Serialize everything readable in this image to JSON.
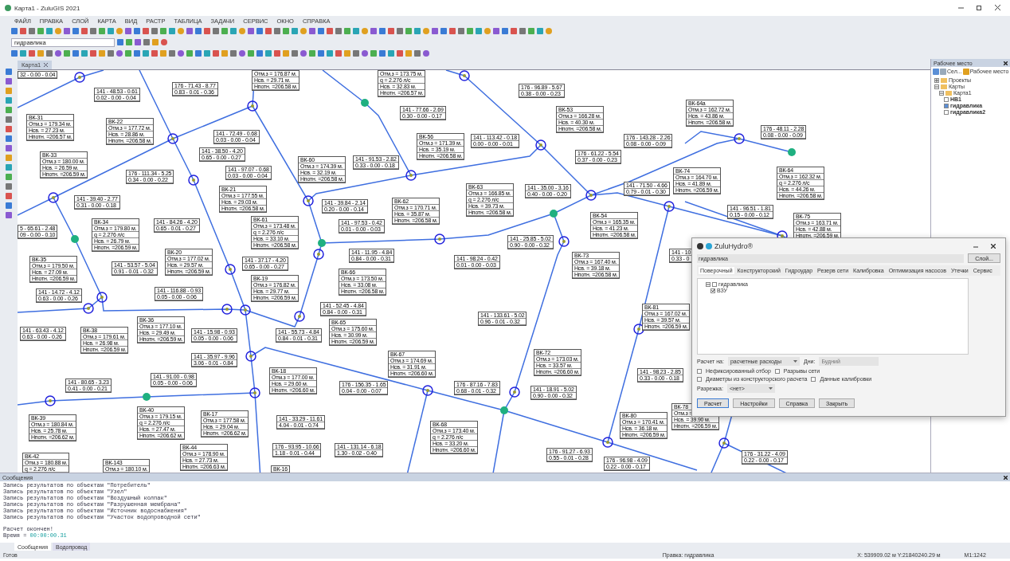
{
  "window": {
    "title": "Карта1 - ZuluGIS 2021"
  },
  "menu": [
    "ФАЙЛ",
    "ПРАВКА",
    "СЛОЙ",
    "КАРТА",
    "ВИД",
    "РАСТР",
    "ТАБЛИЦА",
    "ЗАДАЧИ",
    "СЕРВИС",
    "ОКНО",
    "СПРАВКА"
  ],
  "toolbar": {
    "layer_select": "гидравлика"
  },
  "document_tab": {
    "label": "Карта1"
  },
  "map": {
    "pipe_labels": [
      {
        "lines": [
          "32 - 0.00 - 0.04"
        ]
      },
      {
        "lines": [
          "141 - 48.53 - 0.61",
          "0.02 - 0.00 - 0.04"
        ]
      },
      {
        "lines": [
          "176 - 71.43 - 8.77",
          "0.83 - 0.01 - 0.36"
        ]
      },
      {
        "lines": [
          "176 - 96.89 - 5.67",
          "0.38 - 0.00 - 0.23"
        ]
      },
      {
        "lines": [
          "141 - 77.66 - 2.69",
          "0.30 - 0.00 - 0.17"
        ]
      },
      {
        "lines": [
          "141 - 72.49 - 0.68",
          "0.03 - 0.00 - 0.04"
        ]
      },
      {
        "lines": [
          "141 - 113.42 - 0.18",
          "0.00 - 0.00 - 0.01"
        ]
      },
      {
        "lines": [
          "176 - 143.28 - 2.26",
          "0.08 - 0.00 - 0.09"
        ]
      },
      {
        "lines": [
          "176 - 48.11 - 2.28",
          "0.08 - 0.00 - 0.09"
        ]
      },
      {
        "lines": [
          "141 - 38.50 - 4.20",
          "0.65 - 0.00 - 0.27"
        ]
      },
      {
        "lines": [
          "141 - 91.53 - 2.82",
          "0.33 - 0.00 - 0.18"
        ]
      },
      {
        "lines": [
          "176 - 61.22 - 5.54",
          "0.37 - 0.00 - 0.23"
        ]
      },
      {
        "lines": [
          "176 - 111.34 - 5.25",
          "0.34 - 0.00 - 0.22"
        ]
      },
      {
        "lines": [
          "141 - 97.07 - 0.68",
          "0.03 - 0.00 - 0.04"
        ]
      },
      {
        "lines": [
          "141 - 35.00 - 3.16",
          "0.40 - 0.00 - 0.20"
        ]
      },
      {
        "lines": [
          "141 - 71.50 - 4.66",
          "0.79 - 0.01 - 0.30"
        ]
      },
      {
        "lines": [
          "141 - 39.40 - 2.77",
          "0.31 - 0.00 - 0.18"
        ]
      },
      {
        "lines": [
          "141 - 39.84 - 2.14",
          "0.20 - 0.00 - 0.14"
        ]
      },
      {
        "lines": [
          "141 - 96.51 - 1.81",
          "0.15 - 0.00 - 0.12"
        ]
      },
      {
        "lines": [
          "5 - 65.61 - 2.48",
          "09 - 0.00 - 0.10"
        ]
      },
      {
        "lines": [
          "141 - 84.26 - 4.20",
          "0.65 - 0.01 - 0.27"
        ]
      },
      {
        "lines": [
          "141 - 97.53 - 0.42",
          "0.01 - 0.00 - 0.03"
        ]
      },
      {
        "lines": [
          "141 - 25.85 - 5.02",
          "0.90 - 0.00 - 0.32"
        ]
      },
      {
        "lines": [
          "141 - 53.57 - 5.04",
          "0.91 - 0.01 - 0.32"
        ]
      },
      {
        "lines": [
          "141 - 37.17 - 4.20",
          "0.65 - 0.00 - 0.27"
        ]
      },
      {
        "lines": [
          "141 - 11.95 - 4.84",
          "0.84 - 0.00 - 0.31"
        ]
      },
      {
        "lines": [
          "141 - 98.24 - 0.42",
          "0.01 - 0.00 - 0.03"
        ]
      },
      {
        "lines": [
          "141 - 10",
          "0.33 - 0"
        ]
      },
      {
        "lines": [
          "141 - 14.72 - 4.12",
          "0.63 - 0.00 - 0.26"
        ]
      },
      {
        "lines": [
          "141 - 116.88 - 0.93",
          "0.05 - 0.00 - 0.06"
        ]
      },
      {
        "lines": [
          "141 - 52.45 - 4.84",
          "0.84 - 0.00 - 0.31"
        ]
      },
      {
        "lines": [
          "141 - 133.61 - 5.02",
          "0.96 - 0.01 - 0.32"
        ]
      },
      {
        "lines": [
          "141 - 63.43 - 4.12",
          "0.63 - 0.00 - 0.26"
        ]
      },
      {
        "lines": [
          "141 - 15.98 - 0.93",
          "0.05 - 0.00 - 0.06"
        ]
      },
      {
        "lines": [
          "141 - 55.73 - 4.84",
          "0.84 - 0.01 - 0.31"
        ]
      },
      {
        "lines": [
          "141 - 35.97 - 9.96",
          "3.06 - 0.01 - 0.84"
        ]
      },
      {
        "lines": [
          "141 - 80.65 - 3.23",
          "0.41 - 0.00 - 0.21"
        ]
      },
      {
        "lines": [
          "141 - 91.00 - 0.98",
          "0.05 - 0.00 - 0.06"
        ]
      },
      {
        "lines": [
          "176 - 156.35 - 1.65",
          "0.04 - 0.00 - 0.07"
        ]
      },
      {
        "lines": [
          "176 - 87.16 - 7.83",
          "0.68 - 0.01 - 0.32"
        ]
      },
      {
        "lines": [
          "141 - 18.91 - 5.02",
          "0.90 - 0.00 - 0.32"
        ]
      },
      {
        "lines": [
          "141 - 98.23 - 2.85",
          "0.33 - 0.00 - 0.18"
        ]
      },
      {
        "lines": [
          "141 - 33.29 - 11.61",
          "4.04 - 0.01 - 0.74"
        ]
      },
      {
        "lines": [
          "176 - 93.95 - 10.66",
          "1.18 - 0.01 - 0.44"
        ]
      },
      {
        "lines": [
          "141 - 131.14 - 6.18",
          "1.30 - 0.02 - 0.40"
        ]
      },
      {
        "lines": [
          "176 - 91.27 - 6.93",
          "0.55 - 0.01 - 0.28"
        ]
      },
      {
        "lines": [
          "176 - 96.98 - 4.09",
          "0.22 - 0.00 - 0.17"
        ]
      },
      {
        "lines": [
          "176 - 31.22 - 4.09",
          "0.22 - 0.00 - 0.17"
        ]
      }
    ],
    "node_labels": [
      {
        "lines": [
          "Отм.з = 176.87 м.",
          "Нсв. = 29.71 м.",
          "Нпотн. =206.58 м."
        ]
      },
      {
        "lines": [
          "Отм.з = 173.75 м.",
          "q = 2.276 л/с",
          "Нсв. = 32.83 м.",
          "Нпотн. =206.57 м."
        ]
      },
      {
        "lines": [
          "ВК-31",
          "Отм.з = 179.34 м.",
          "Нсв. = 27.23 м.",
          "Нпотн. =206.57 м."
        ]
      },
      {
        "lines": [
          "ВК-22",
          "Отм.з = 177.72 м.",
          "Нсв. = 28.86 м.",
          "Нпотн. =206.58 м."
        ]
      },
      {
        "lines": [
          "ВК-53",
          "Отм.з = 166.28 м.",
          "Нсв. = 40.30 м.",
          "Нпотн. =206.58 м."
        ]
      },
      {
        "lines": [
          "ВК-64а",
          "Отм.з = 162.72 м.",
          "Нсв. = 43.86 м.",
          "Нпотн. =206.58 м."
        ]
      },
      {
        "lines": [
          "ВК-56",
          "Отм.з = 171.39 м.",
          "Нсв. = 35.19 м.",
          "Нпотн. =206.58 м."
        ]
      },
      {
        "lines": [
          "ВК-33",
          "Отм.з = 180.00 м.",
          "Нсв. = 26.59 м.",
          "Нпотн. =206.59 м."
        ]
      },
      {
        "lines": [
          "ВК-60",
          "Отм.з = 174.39 м.",
          "Нсв. = 32.19 м.",
          "Нпотн. =206.58 м."
        ]
      },
      {
        "lines": [
          "ВК-74",
          "Отм.з = 164.70 м.",
          "Нсв. = 41.89 м.",
          "Нпотн. =206.59 м."
        ]
      },
      {
        "lines": [
          "ВК-21",
          "Отм.з = 177.55 м.",
          "Нсв. = 29.03 м.",
          "Нпотн. =206.58 м."
        ]
      },
      {
        "lines": [
          "ВК-62",
          "Отм.з = 170.71 м.",
          "Нсв. = 35.87 м.",
          "Нпотн. =206.58 м."
        ]
      },
      {
        "lines": [
          "ВК-63",
          "Отм.з = 166.85 м.",
          "q = 2.276 л/с",
          "Нсв. = 39.73 м.",
          "Нпотн. =206.58 м."
        ]
      },
      {
        "lines": [
          "ВК-64",
          "Отм.з = 162.32 м.",
          "q = 2.276 л/с",
          "Нсв. = 44.26 м.",
          "Нпотн. =206.58 м."
        ]
      },
      {
        "lines": [
          "ВК-34",
          "Отм.з = 179.80 м.",
          "q = 2.276 л/с",
          "Нсв. = 26.79 м.",
          "Нпотн. =206.59 м."
        ]
      },
      {
        "lines": [
          "ВК-61",
          "Отм.з = 173.48 м.",
          "q = 2.276 л/с",
          "Нсв. = 33.10 м.",
          "Нпотн. =206.58 м."
        ]
      },
      {
        "lines": [
          "ВК-54",
          "Отм.з = 165.35 м.",
          "Нсв. = 41.23 м.",
          "Нпотн. =206.58 м."
        ]
      },
      {
        "lines": [
          "ВК-75",
          "Отм.з = 163.71 м.",
          "Нсв. = 42.88 м.",
          "Нпотн. =206.59 м."
        ]
      },
      {
        "lines": [
          "ВК-35",
          "Отм.з = 179.50 м.",
          "Нсв. = 27.09 м.",
          "Нпотн. =206.59 м."
        ]
      },
      {
        "lines": [
          "ВК-20",
          "Отм.з = 177.02 м.",
          "Нсв. = 29.57 м.",
          "Нпотн. =206.59 м."
        ]
      },
      {
        "lines": [
          "ВК-73",
          "Отм.з = 167.40 м.",
          "Нсв. = 39.18 м.",
          "Нпотн. =206.58 м."
        ]
      },
      {
        "lines": [
          "ВК-19",
          "Отм.з = 176.82 м.",
          "Нсв. = 29.77 м.",
          "Нпотн. =206.59 м."
        ]
      },
      {
        "lines": [
          "ВК-66",
          "Отм.з = 173.50 м.",
          "Нсв. = 33.08 м.",
          "Нпотн. =206.58 м."
        ]
      },
      {
        "lines": [
          "ВК-38",
          "Отм.з = 179.61 м.",
          "Нсв. = 26.98 м.",
          "Нпотн. =206.59 м."
        ]
      },
      {
        "lines": [
          "ВК-36",
          "Отм.з = 177.10 м.",
          "Нсв. = 29.49 м.",
          "Нпотн. =206.59 м."
        ]
      },
      {
        "lines": [
          "ВК-65",
          "Отм.з = 175.60 м.",
          "Нсв. = 30.99 м.",
          "Нпотн. =206.59 м."
        ]
      },
      {
        "lines": [
          "ВК-81",
          "Отм.з = 167.02 м.",
          "Нсв. = 39.57 м.",
          "Нпотн. =206.59 м."
        ]
      },
      {
        "lines": [
          "ВК-67",
          "Отм.з = 174.69 м.",
          "Нсв. = 31.91 м.",
          "Нпотн. =206.60 м."
        ]
      },
      {
        "lines": [
          "ВК-72",
          "Отм.з = 173.03 м.",
          "Нсв. = 33.57 м.",
          "Нпотн. =206.60 м."
        ]
      },
      {
        "lines": [
          "ВК-18",
          "Отм.з = 177.00 м.",
          "Нсв. = 29.60 м.",
          "Нпотн. =206.60 м."
        ]
      },
      {
        "lines": [
          "ВК-39",
          "Отм.з = 180.84 м.",
          "Нсв. = 25.78 м.",
          "Нпотн. =206.62 м."
        ]
      },
      {
        "lines": [
          "ВК-40",
          "Отм.з = 179.15 м.",
          "q = 2.276 л/с",
          "Нсв. = 27.47 м.",
          "Нпотн. =206.62 м."
        ]
      },
      {
        "lines": [
          "ВК-17",
          "Отм.з = 177.58 м.",
          "Нсв. = 29.04 м.",
          "Нпотн. =206.62 м."
        ]
      },
      {
        "lines": [
          "ВК-68",
          "Отм.з = 173.40 м.",
          "q = 2.276 л/с",
          "Нсв. = 33.20 м.",
          "Нпотн. =206.60 м."
        ]
      },
      {
        "lines": [
          "ВК-80",
          "Отм.з = 170.41 м.",
          "Нсв. = 36.18 м.",
          "Нпотн. =206.59 м."
        ]
      },
      {
        "lines": [
          "ВК-78",
          "Отм.з =",
          "Нсв. = 39.90 м.",
          "Нпотн. =206.59 м."
        ]
      },
      {
        "lines": [
          "ВК-42",
          "Отм.з = 180.88 м.",
          "q = 2.276 л/с"
        ]
      },
      {
        "lines": [
          "ВК-143",
          "Отм.з = 180.10 м."
        ]
      },
      {
        "lines": [
          "ВК-44",
          "Отм.з = 178.90 м.",
          "Нсв. = 27.73 м.",
          "Нпотн. =206.63 м."
        ]
      },
      {
        "lines": [
          "ВК-16"
        ]
      }
    ]
  },
  "workspace": {
    "title": "Рабочее место",
    "tool_labels": [
      "Сел...",
      "Рабочее место"
    ],
    "tree": [
      {
        "label": "Проекты",
        "expanded": false
      },
      {
        "label": "Карты",
        "expanded": true,
        "children": [
          {
            "label": "Карта1",
            "expanded": true,
            "children": [
              {
                "label": "НВ1",
                "checked": false
              },
              {
                "label": "гидравлика",
                "checked": true
              },
              {
                "label": "гидравлика2",
                "checked": false
              }
            ]
          }
        ]
      }
    ]
  },
  "dialog": {
    "title": "ZuluHydro®",
    "layer": "гидравлика",
    "layer_button": "Слой...",
    "tabs": [
      {
        "label": "Поверочный",
        "selected": true
      },
      {
        "label": "Конструкторский",
        "selected": false
      },
      {
        "label": "Гидроудар",
        "selected": false
      },
      {
        "label": "Резерв сети",
        "selected": false
      },
      {
        "label": "Калибровка",
        "selected": false
      },
      {
        "label": "Оптимизация насосов",
        "selected": false
      },
      {
        "label": "Утечки",
        "selected": false
      },
      {
        "label": "Сервис",
        "selected": false
      }
    ],
    "tree": [
      {
        "label": "гидравлика",
        "checked": false,
        "expanded": true,
        "children": [
          {
            "label": "ВЗУ",
            "checked": true
          }
        ]
      }
    ],
    "calc_label": "Расчет на:",
    "calc_value": "расчетные расходы",
    "days_label": "Дни:",
    "days_value": "Будний",
    "options": [
      {
        "label": "Нефиксированный отбор",
        "checked": false
      },
      {
        "label": "Разрывы сети",
        "checked": false
      },
      {
        "label": "Диаметры из конструкторского расчета",
        "checked": false
      },
      {
        "label": "Данные калибровки",
        "checked": false
      }
    ],
    "cut_label": "Разрежка:",
    "cut_value": "<нет>",
    "buttons": [
      {
        "label": "Расчет",
        "selected": true
      },
      {
        "label": "Настройки",
        "selected": false
      },
      {
        "label": "Справка",
        "selected": false
      },
      {
        "label": "Закрыть",
        "selected": false
      }
    ]
  },
  "messages": {
    "title": "Сообщения",
    "log": [
      "Запись результатов по объектам \"Потребитель\"",
      "Запись результатов по объектам \"Узел\"",
      "Запись результатов по объектам \"Воздушный колпак\"",
      "Запись результатов по объектам \"Разрушенная мембрана\"",
      "Запись результатов по объектам \"Источник водоснабжения\"",
      "Запись результатов по объектам \"Участок водопроводной сети\""
    ],
    "status": "Расчет окончен!",
    "time_label": "Время =",
    "time_value": "00:00:00.31",
    "tabs": [
      {
        "label": "Сообщения",
        "selected": true
      },
      {
        "label": "Водопровод",
        "selected": false
      }
    ]
  },
  "status_bar": [
    "Готов",
    "Правка: гидравлика",
    "X: 539909.02 м  Y:21840240.29 м",
    "M1:1242"
  ]
}
